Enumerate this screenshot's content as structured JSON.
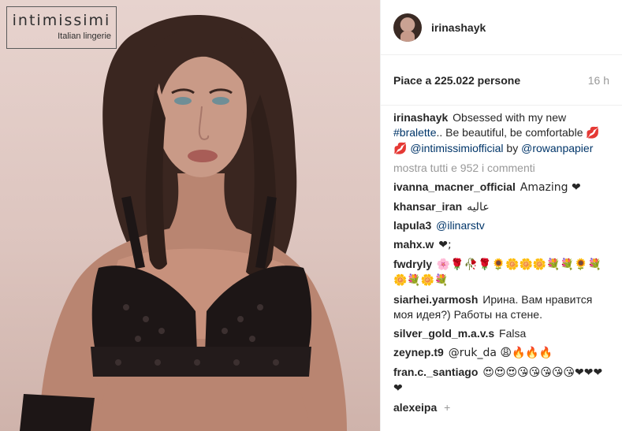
{
  "brand": {
    "name": "intimissimi",
    "tagline": "Italian lingerie"
  },
  "header": {
    "username": "irinashayk"
  },
  "post": {
    "likes": "Piace a 225.022 persone",
    "time": "16 h"
  },
  "caption": {
    "user": "irinashayk",
    "text_1": "Obsessed with my new",
    "hashtag": "#bralette",
    "text_2": ".. Be beautiful, be comfortable",
    "emoji": "💋💋",
    "mention": "@intimissimiofficial",
    "text_3": "by",
    "mention_2": "@rowanpapier"
  },
  "comments_header": {
    "show_all": "mostra tutti e 952 i commenti"
  },
  "comments": [
    {
      "user": "ivanna_macner_official",
      "text": "Amazing ❤"
    },
    {
      "user": "khansar_iran",
      "text": "عاليه"
    },
    {
      "user": "lapula3",
      "text": "@ilinarstv"
    },
    {
      "user": "mahx.w",
      "text": "❤;"
    },
    {
      "user": "fwdryly",
      "text": "🌸🌹🥀🌹🌻🌼🌼🌼💐💐🌻💐🌼💐🌼💐"
    },
    {
      "user": "siarhei.yarmosh",
      "text": "Ирина. Вам нравится моя идея?) Работы на стене."
    },
    {
      "user": "silver_gold_m.a.v.s",
      "text": "Falsa"
    },
    {
      "user": "zeynep.t9",
      "text": "@ruk_da 😩🔥🔥🔥"
    },
    {
      "user": "fran.c._santiago",
      "text": "😍😍😍😘😘😘😘😘❤❤❤❤"
    },
    {
      "user": "alexeipa",
      "text": "+"
    }
  ],
  "icons": {
    "avatar": "avatar-irinashayk"
  },
  "colors": {
    "link": "#003569",
    "muted": "#999999",
    "text": "#262626",
    "photo_bg": "#e2ccc6"
  }
}
